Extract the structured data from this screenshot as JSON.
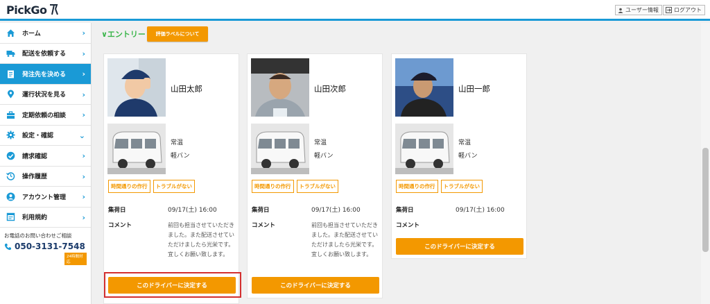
{
  "header": {
    "logo": "PickGo",
    "user_info": "ユーザー情報",
    "logout": "ログアウト"
  },
  "sidebar": {
    "items": [
      {
        "label": "ホーム",
        "icon": "home-icon"
      },
      {
        "label": "配送を依頼する",
        "icon": "truck-icon"
      },
      {
        "label": "発注先を決める",
        "icon": "clipboard-icon",
        "active": true
      },
      {
        "label": "運行状況を見る",
        "icon": "location-pin-icon"
      },
      {
        "label": "定期依頼の相談",
        "icon": "briefcase-icon"
      },
      {
        "label": "設定・確認",
        "icon": "gear-icon"
      },
      {
        "label": "請求確認",
        "icon": "check-circle-icon"
      },
      {
        "label": "操作履歴",
        "icon": "history-icon"
      },
      {
        "label": "アカウント管理",
        "icon": "account-icon"
      },
      {
        "label": "利用規約",
        "icon": "document-icon"
      }
    ],
    "contact_label": "お電話のお問い合わせご相談",
    "phone": "050-3131-7548",
    "badge": "24時間対応"
  },
  "main": {
    "title": "∨エントリー",
    "eval_button": "評価ラベルについて",
    "labels": {
      "date": "集荷日",
      "comment": "コメント",
      "decide": "このドライバーに決定する"
    },
    "drivers": [
      {
        "name": "山田太郎",
        "temp": "常温",
        "vehicle": "軽バン",
        "tags": [
          "時間通りの作行",
          "トラブルがない"
        ],
        "date": "09/17(土) 16:00",
        "comment": "前回も担当させていただきました。また配送させていただけましたら光栄です。宜しくお願い致します。"
      },
      {
        "name": "山田次郎",
        "temp": "常温",
        "vehicle": "軽バン",
        "tags": [
          "時間通りの作行",
          "トラブルがない"
        ],
        "date": "09/17(土) 16:00",
        "comment": "前回も担当させていただきました。また配送させていただけましたら光栄です。宜しくお願い致します。"
      },
      {
        "name": "山田一郎",
        "temp": "常温",
        "vehicle": "軽バン",
        "tags": [
          "時間通りの作行",
          "トラブルがない"
        ],
        "date": "09/17(土) 16:00",
        "comment": ""
      }
    ]
  },
  "colors": {
    "accent": "#1a9ad6",
    "orange": "#f39800",
    "green": "#3ab54a",
    "highlight": "#d32f2f"
  }
}
